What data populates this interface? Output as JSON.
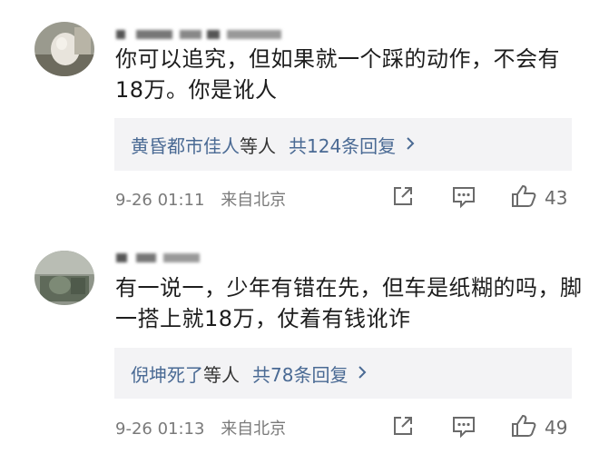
{
  "comments": [
    {
      "text": "你可以追究，但如果就一个踩的动作，不会有18万。你是讹人",
      "replies": {
        "name": "黄昏都市佳人",
        "etc": "等人",
        "count": "共124条回复"
      },
      "time": "9-26 01:11",
      "location": "来自北京",
      "likes": "43"
    },
    {
      "text": "有一说一，少年有错在先，但车是纸糊的吗，脚一搭上就18万，仗着有钱讹诈",
      "replies": {
        "name": "倪坤死了",
        "etc": "等人",
        "count": "共78条回复"
      },
      "time": "9-26 01:13",
      "location": "来自北京",
      "likes": "49"
    }
  ],
  "icons": {
    "share": "share-icon",
    "comment": "comment-icon",
    "like": "thumbs-up-icon",
    "chevron": "chevron-right-icon"
  },
  "colors": {
    "link": "#4a6a94",
    "reply_bg": "#f3f3f5",
    "meta": "#7a7a7a"
  }
}
